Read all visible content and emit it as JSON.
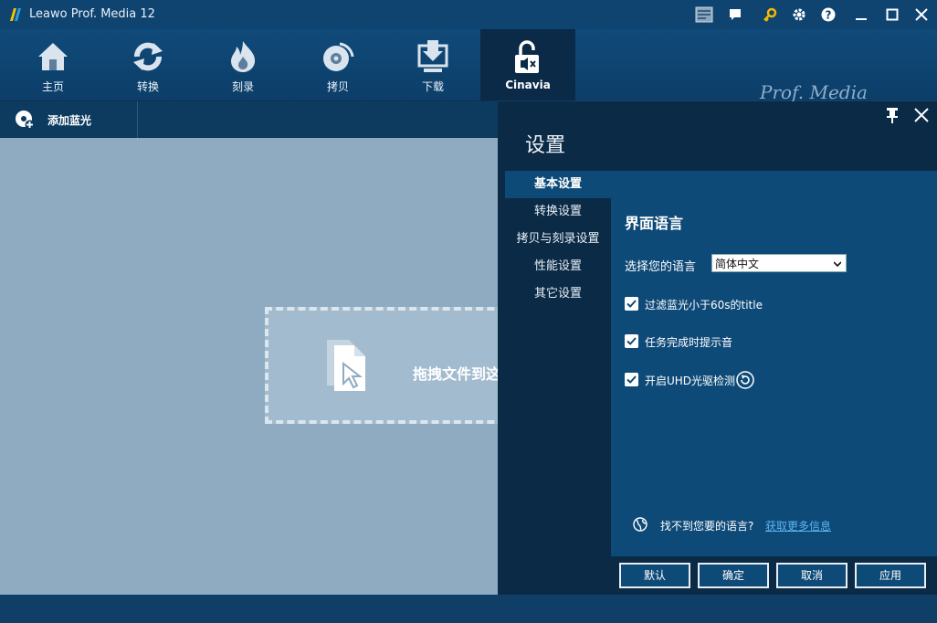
{
  "titlebar": {
    "title": "Leawo Prof. Media 12",
    "icons": [
      "shop-icon",
      "feedback-icon",
      "key-icon",
      "gear-icon",
      "help-icon",
      "minimize-icon",
      "maximize-icon",
      "close-icon"
    ]
  },
  "nav": {
    "items": [
      {
        "label": "主页",
        "icon": "home-icon"
      },
      {
        "label": "转换",
        "icon": "convert-icon"
      },
      {
        "label": "刻录",
        "icon": "burn-icon"
      },
      {
        "label": "拷贝",
        "icon": "copy-icon"
      },
      {
        "label": "下载",
        "icon": "download-icon"
      },
      {
        "label": "Cinavia",
        "icon": "cinavia-icon"
      }
    ],
    "active_index": 5,
    "brand": "Prof. Media"
  },
  "toolbar": {
    "add_label": "添加蓝光"
  },
  "workspace": {
    "drop_text": "拖拽文件到这里"
  },
  "settings": {
    "title": "设置",
    "nav": [
      "基本设置",
      "转换设置",
      "拷贝与刻录设置",
      "性能设置",
      "其它设置"
    ],
    "active_nav": 0,
    "section_title": "界面语言",
    "language_label": "选择您的语言",
    "language_value": "简体中文",
    "checkboxes": [
      {
        "label": "过滤蓝光小于60s的title",
        "checked": true
      },
      {
        "label": "任务完成时提示音",
        "checked": true
      },
      {
        "label": "开启UHD光驱检测",
        "checked": true
      }
    ],
    "help_question": "找不到您要的语言?",
    "help_link": "获取更多信息",
    "buttons": {
      "default": "默认",
      "ok": "确定",
      "cancel": "取消",
      "apply": "应用"
    }
  },
  "colors": {
    "accent": "#0e4a78",
    "titlebar": "#0f4370",
    "panel_dark": "#0b2a45",
    "workspace": "#8fabc1",
    "link": "#5cb3f0"
  }
}
